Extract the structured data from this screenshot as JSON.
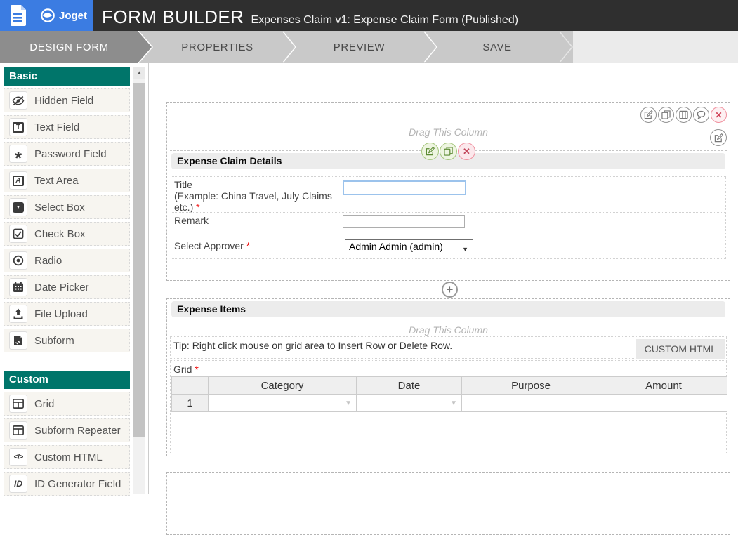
{
  "header": {
    "brand": "Joget",
    "title": "FORM BUILDER",
    "subtitle": "Expenses Claim v1: Expense Claim Form (Published)"
  },
  "tabs": {
    "design": "DESIGN FORM",
    "properties": "PROPERTIES",
    "preview": "PREVIEW",
    "save": "SAVE"
  },
  "palette": {
    "sections": [
      {
        "title": "Basic",
        "items": [
          {
            "label": "Hidden Field",
            "icon": "eye-slash-icon"
          },
          {
            "label": "Text Field",
            "icon": "text-field-icon"
          },
          {
            "label": "Password Field",
            "icon": "asterisk-icon"
          },
          {
            "label": "Text Area",
            "icon": "text-area-icon"
          },
          {
            "label": "Select Box",
            "icon": "select-box-icon"
          },
          {
            "label": "Check Box",
            "icon": "check-box-icon"
          },
          {
            "label": "Radio",
            "icon": "radio-icon"
          },
          {
            "label": "Date Picker",
            "icon": "calendar-icon"
          },
          {
            "label": "File Upload",
            "icon": "upload-icon"
          },
          {
            "label": "Subform",
            "icon": "file-icon"
          }
        ]
      },
      {
        "title": "Custom",
        "items": [
          {
            "label": "Grid",
            "icon": "table-icon"
          },
          {
            "label": "Subform Repeater",
            "icon": "table-icon"
          },
          {
            "label": "Custom HTML",
            "icon": "code-icon"
          },
          {
            "label": "ID Generator Field",
            "icon": "id-icon"
          }
        ]
      }
    ]
  },
  "canvas": {
    "drag_column_label": "Drag This Column",
    "required_marker": "*",
    "section_details": {
      "title": "Expense Claim Details",
      "fields": {
        "title": {
          "line1": "Title",
          "line2": "(Example: China Travel, July Claims",
          "line3": "etc.)",
          "value": ""
        },
        "remark": {
          "label": "Remark",
          "value": ""
        },
        "approver": {
          "label": "Select Approver",
          "value": "Admin Admin (admin)"
        }
      }
    },
    "section_items": {
      "title": "Expense Items",
      "tip": "Tip: Right click mouse on grid area to Insert Row or Delete Row.",
      "badge": "CUSTOM HTML",
      "grid_label": "Grid",
      "grid": {
        "headers": [
          "",
          "Category",
          "Date",
          "Purpose",
          "Amount"
        ],
        "row_number": "1"
      }
    }
  },
  "glyphs": {
    "dropdown": "▼",
    "plus": "+",
    "close": "✕",
    "scroll_up": "▲",
    "code": "</>",
    "id": "ID",
    "letter_t": "T",
    "letter_a": "A",
    "asterisk": "*"
  },
  "colors": {
    "brand_blue": "#3b7ce2",
    "header_dark": "#2f2f2f",
    "teal": "#00756a",
    "active_tab": "#8d8d8d",
    "required_red": "#e00000"
  }
}
